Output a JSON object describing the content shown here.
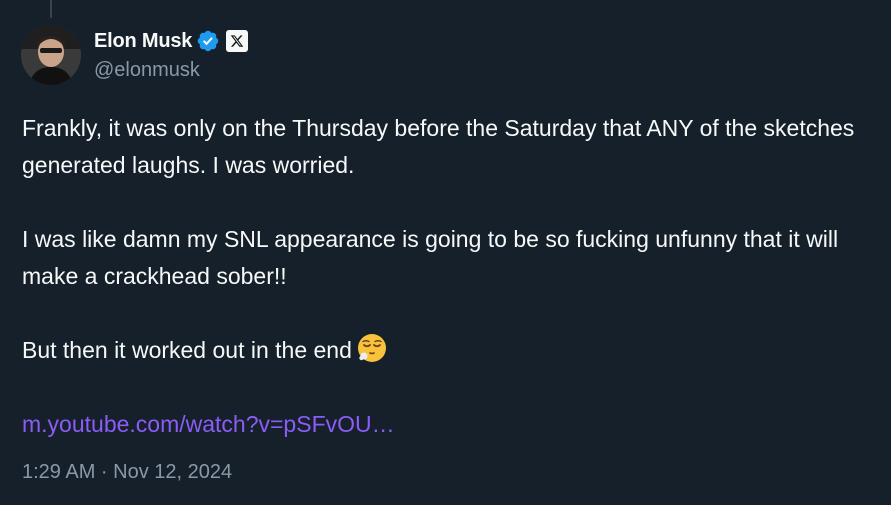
{
  "author": {
    "display_name": "Elon Musk",
    "handle": "@elonmusk",
    "avatar_icon": "profile-photo",
    "verified_icon": "verified-badge-icon",
    "affiliate_icon": "x-logo-icon"
  },
  "tweet": {
    "paragraphs": [
      "Frankly, it was only on the Thursday before the Saturday that ANY of the sketches generated laughs. I was worried.",
      "I was like damn my SNL appearance is going to be so fucking unfunny that it will make a crackhead sober!!",
      "But then it worked out in the end"
    ],
    "emoji_icon": "relieved-face-icon",
    "link_text": "m.youtube.com/watch?v=pSFvOU…"
  },
  "meta": {
    "timestamp": "1:29 AM · Nov 12, 2024"
  },
  "colors": {
    "background": "#15202b",
    "text_primary": "#f7f9f9",
    "text_secondary": "#8b98a5",
    "verified_blue": "#1d9bf0",
    "link": "#8b5cf6"
  }
}
